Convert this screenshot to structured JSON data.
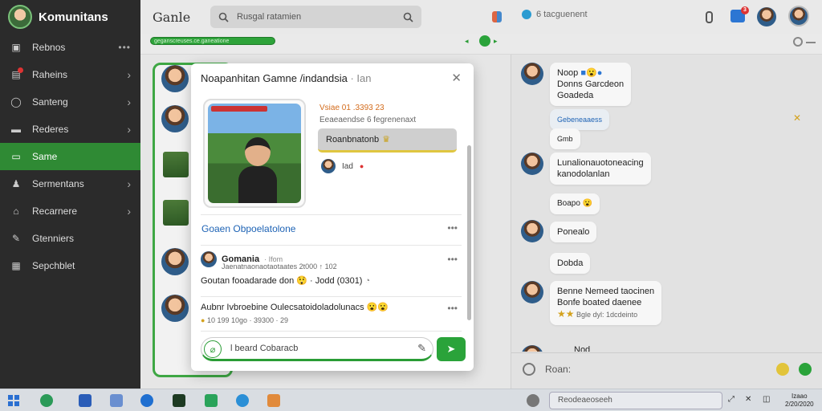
{
  "sidebar": {
    "brand": "Komunitans",
    "items": [
      {
        "label": "Rebnos",
        "icon": "briefcase-icon",
        "trail": "dots"
      },
      {
        "label": "Raheins",
        "icon": "bell-icon",
        "trail": "chevron",
        "badge": true
      },
      {
        "label": "Santeng",
        "icon": "chat-icon",
        "trail": "chevron"
      },
      {
        "label": "Rederes",
        "icon": "folder-icon",
        "trail": "chevron"
      },
      {
        "label": "Same",
        "icon": "window-icon",
        "trail": "",
        "active": true
      },
      {
        "label": "Sermentans",
        "icon": "users-icon",
        "trail": "chevron"
      },
      {
        "label": "Recarnere",
        "icon": "home-icon",
        "trail": "chevron"
      },
      {
        "label": "Gtenniers",
        "icon": "wrench-icon",
        "trail": ""
      },
      {
        "label": "Sepchblet",
        "icon": "box-icon",
        "trail": ""
      }
    ]
  },
  "topbar": {
    "title": "Ganle",
    "search_value": "Rusgal ratamien",
    "tab_label": "6 tacguenent"
  },
  "subbar": {
    "pill_text": "geganscreuses.ce.ganeatione"
  },
  "modal": {
    "title": "Noapanhitan Gamne /indandsia",
    "title_suffix": "· Ian",
    "info_top": "Vsiae 01 .3393 23",
    "info_sub": "Eeaeaendse 6 fegrenenaxt",
    "play_label": "Roanbnatonb",
    "stat_label": "Iad",
    "section_title": "Goaen Obpoelatolone",
    "posts": [
      {
        "author": "Gomania",
        "time": "· Ifom",
        "meta": "Jaenatnaonaotaotaates 2t000 ↑ 102",
        "text": "Goutan fooadarade don",
        "text2": "· Jodd (0301)"
      },
      {
        "author": "",
        "time": "",
        "meta": "10 199 10go · 39300 · 29",
        "text": "Aubnr Ivbroebine Oulecsatoidoladolunacs",
        "text2": ""
      }
    ],
    "composer_placeholder": "l beard Cobaracb"
  },
  "chat": {
    "messages": [
      {
        "name": "Noop",
        "lines": [
          "Donns Garcdeon",
          "Goadeda"
        ]
      },
      {
        "name": "",
        "lines": [
          "Gebeneaaess"
        ]
      },
      {
        "name": "",
        "lines": [
          "Gmb"
        ]
      },
      {
        "name": "",
        "lines": [
          "Lunalionauotoneacing",
          "kanodolanlan"
        ]
      },
      {
        "name": "",
        "lines": [
          "Boapo"
        ]
      },
      {
        "name": "",
        "lines": [
          "Ponealo"
        ]
      },
      {
        "name": "",
        "lines": [
          "Dobda"
        ]
      },
      {
        "name": "",
        "lines": [
          "Benne Nemeed taocinen",
          "Bonfe boated daenee",
          "Bgle dyl: 1dcdeinto"
        ]
      },
      {
        "name": "Nod",
        "lines": []
      }
    ],
    "input_placeholder": "Roan:"
  },
  "taskbar": {
    "search_placeholder": "Reodeaeoseeh",
    "clock_time": "Izaao",
    "clock_date": "2/20/2020"
  },
  "colors": {
    "accent": "#2f8a34",
    "link": "#1e63b5",
    "sidebar": "#2b2b2b"
  }
}
